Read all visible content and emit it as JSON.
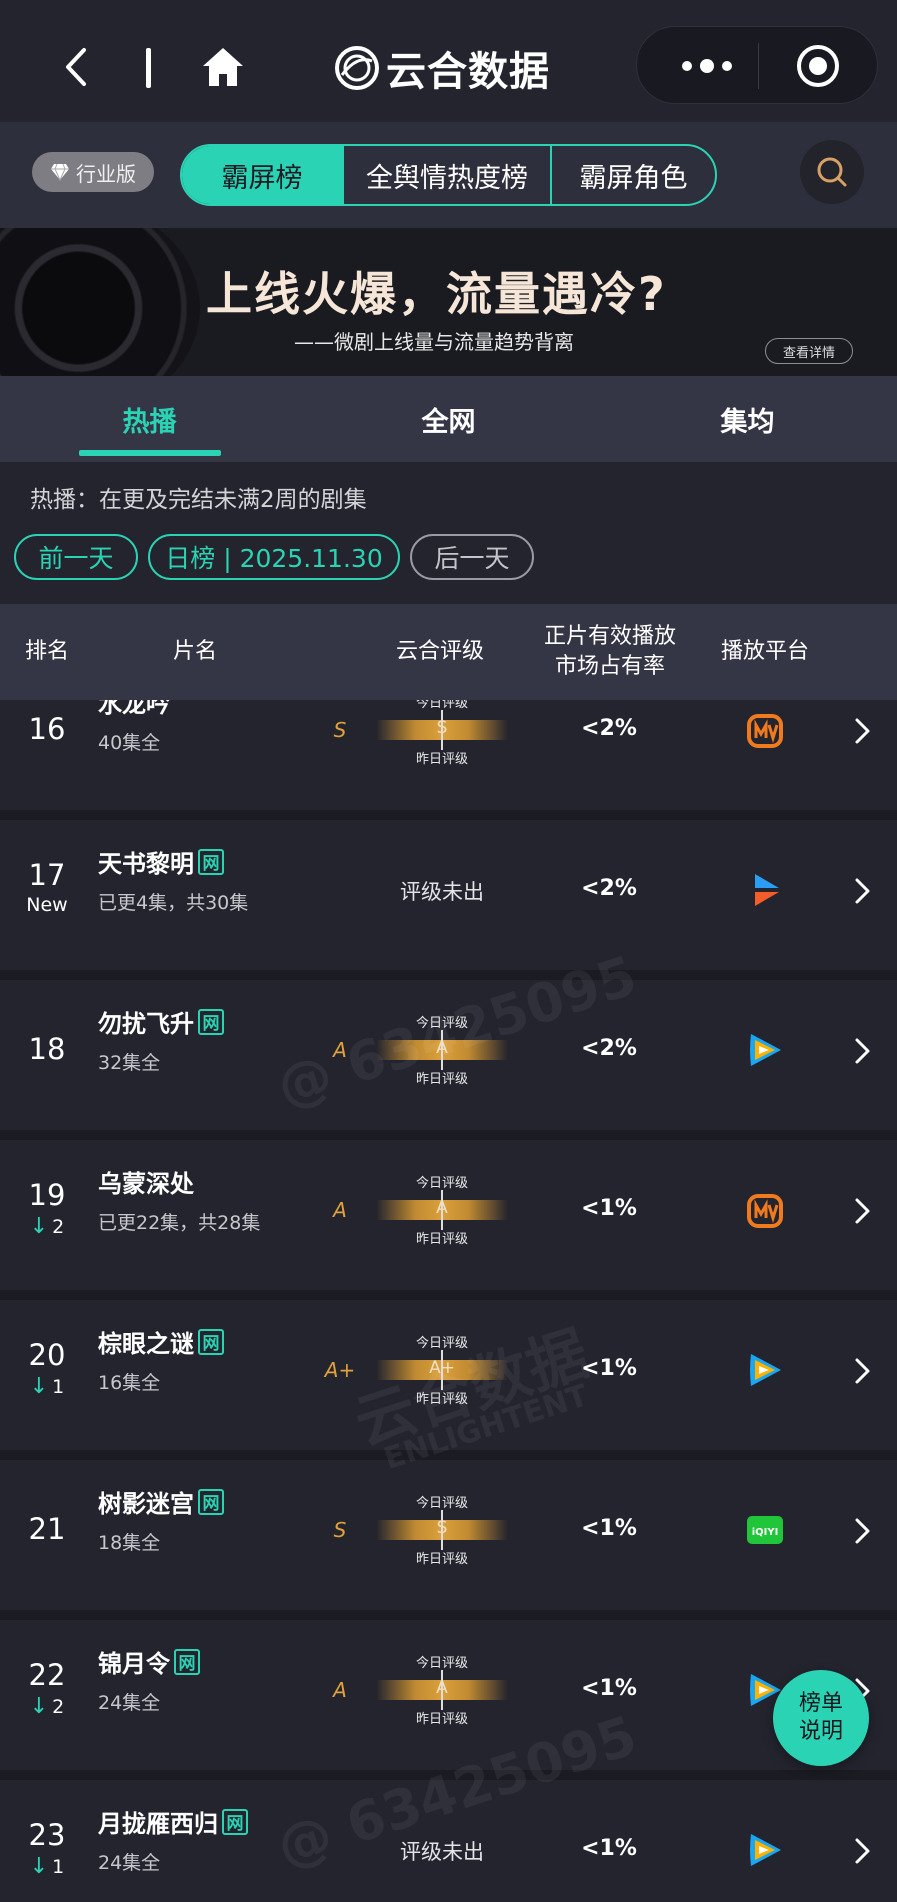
{
  "nav": {
    "brand": "云合数据"
  },
  "filter": {
    "industry_label": "行业版",
    "segments": [
      "霸屏榜",
      "全舆情热度榜",
      "霸屏角色"
    ],
    "active_segment": "霸屏榜"
  },
  "banner": {
    "title": "上线火爆，流量遇冷?",
    "subtitle": "——微剧上线量与流量趋势背离",
    "button": "查看详情"
  },
  "tabs": [
    "热播",
    "全网",
    "集均"
  ],
  "active_tab": "热播",
  "description": "热播：在更及完结未满2周的剧集",
  "dates": {
    "prev": "前一天",
    "current": "日榜 | 2025.11.30",
    "next": "后一天"
  },
  "table": {
    "headers": {
      "rank": "排名",
      "title": "片名",
      "rating": "云合评级",
      "share_line1": "正片有效播放",
      "share_line2": "市场占有率",
      "platform": "播放平台"
    },
    "grade_label_today": "今日评级",
    "grade_label_yesterday": "昨日评级",
    "net_tag": "网",
    "rows": [
      {
        "rank": "16",
        "change": "",
        "title": "水龙吟",
        "net": false,
        "info": "40集全",
        "grade": "S",
        "share": "<2%",
        "platform": "mango"
      },
      {
        "rank": "17",
        "change": "New",
        "title": "天书黎明",
        "net": true,
        "info": "已更4集，共30集",
        "grade": "",
        "no_grade": "评级未出",
        "share": "<2%",
        "platform": "youku"
      },
      {
        "rank": "18",
        "change": "",
        "title": "勿扰飞升",
        "net": true,
        "info": "32集全",
        "grade": "A",
        "share": "<2%",
        "platform": "tencent"
      },
      {
        "rank": "19",
        "change": "2",
        "title": "乌蒙深处",
        "net": false,
        "info": "已更22集，共28集",
        "grade": "A",
        "share": "<1%",
        "platform": "mango"
      },
      {
        "rank": "20",
        "change": "1",
        "title": "棕眼之谜",
        "net": true,
        "info": "16集全",
        "grade": "A+",
        "share": "<1%",
        "platform": "tencent"
      },
      {
        "rank": "21",
        "change": "",
        "title": "树影迷宫",
        "net": true,
        "info": "18集全",
        "grade": "S",
        "share": "<1%",
        "platform": "iqiyi"
      },
      {
        "rank": "22",
        "change": "2",
        "title": "锦月令",
        "net": true,
        "info": "24集全",
        "grade": "A",
        "share": "<1%",
        "platform": "tencent"
      },
      {
        "rank": "23",
        "change": "1",
        "title": "月拢雁西归",
        "net": true,
        "info": "24集全",
        "grade": "",
        "no_grade": "评级未出",
        "share": "<1%",
        "platform": "tencent"
      }
    ]
  },
  "fab": {
    "line1": "榜单",
    "line2": "说明"
  },
  "watermarks": {
    "id": "@ 63425095",
    "brand": "云合数据",
    "brand_en": "ENLIGHTENT"
  },
  "colors": {
    "accent": "#2bd3b5",
    "background": "#23242e",
    "grade": "#e0a23a"
  }
}
